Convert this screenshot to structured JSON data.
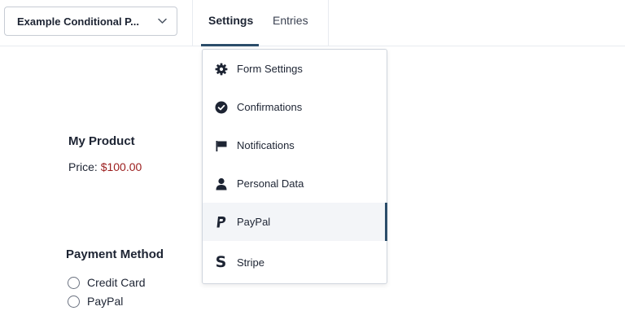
{
  "header": {
    "form_select": {
      "label": "Example Conditional P...",
      "icon": "chevron-down-icon"
    },
    "tabs": [
      {
        "label": "Settings",
        "active": true
      },
      {
        "label": "Entries",
        "active": false
      }
    ]
  },
  "product": {
    "title": "My Product",
    "price_label": "Price:",
    "price_value": "$100.00"
  },
  "payment": {
    "title": "Payment Method",
    "options": [
      {
        "label": "Credit Card",
        "selected": false
      },
      {
        "label": "PayPal",
        "selected": false
      }
    ]
  },
  "settings_menu": {
    "items": [
      {
        "label": "Form Settings",
        "icon": "gear-icon"
      },
      {
        "label": "Confirmations",
        "icon": "check-circle-icon"
      },
      {
        "label": "Notifications",
        "icon": "flag-icon"
      },
      {
        "label": "Personal Data",
        "icon": "user-icon"
      },
      {
        "label": "PayPal",
        "icon": "paypal-icon",
        "active": true
      },
      {
        "label": "Stripe",
        "icon": "stripe-icon",
        "glyph": "S"
      }
    ]
  },
  "colors": {
    "accent": "#2b4d6a",
    "price": "#9b1c1c",
    "text": "#1d2433"
  }
}
